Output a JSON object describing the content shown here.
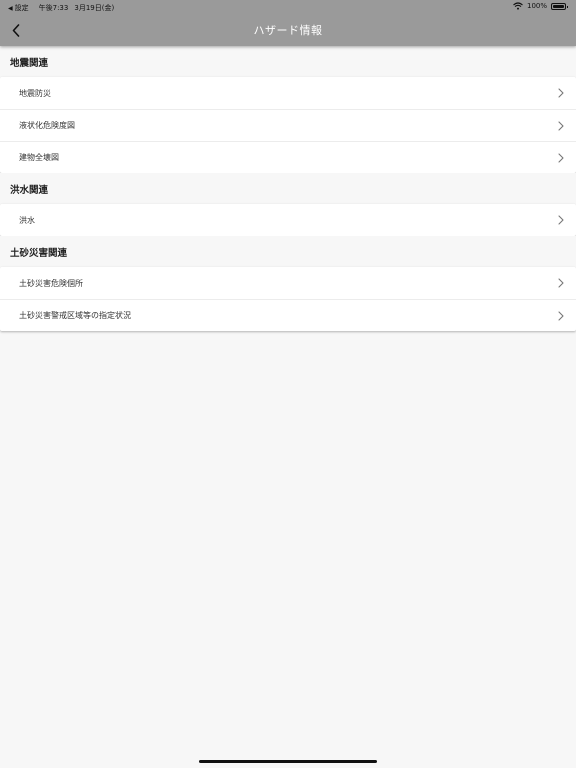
{
  "statusbar": {
    "back_label": "設定",
    "time": "午後7:33",
    "date": "3月19日(金)",
    "battery_percent": "100%"
  },
  "navbar": {
    "title": "ハザード情報",
    "back_icon": "chevron-left-icon"
  },
  "sections": [
    {
      "title": "地震関連",
      "items": [
        {
          "label": "地震防災"
        },
        {
          "label": "液状化危険度図"
        },
        {
          "label": "建物全壊図"
        }
      ]
    },
    {
      "title": "洪水関連",
      "items": [
        {
          "label": "洪水"
        }
      ]
    },
    {
      "title": "土砂災害関連",
      "items": [
        {
          "label": "土砂災害危険個所"
        },
        {
          "label": "土砂災害警戒区域等の指定状況"
        }
      ]
    }
  ]
}
